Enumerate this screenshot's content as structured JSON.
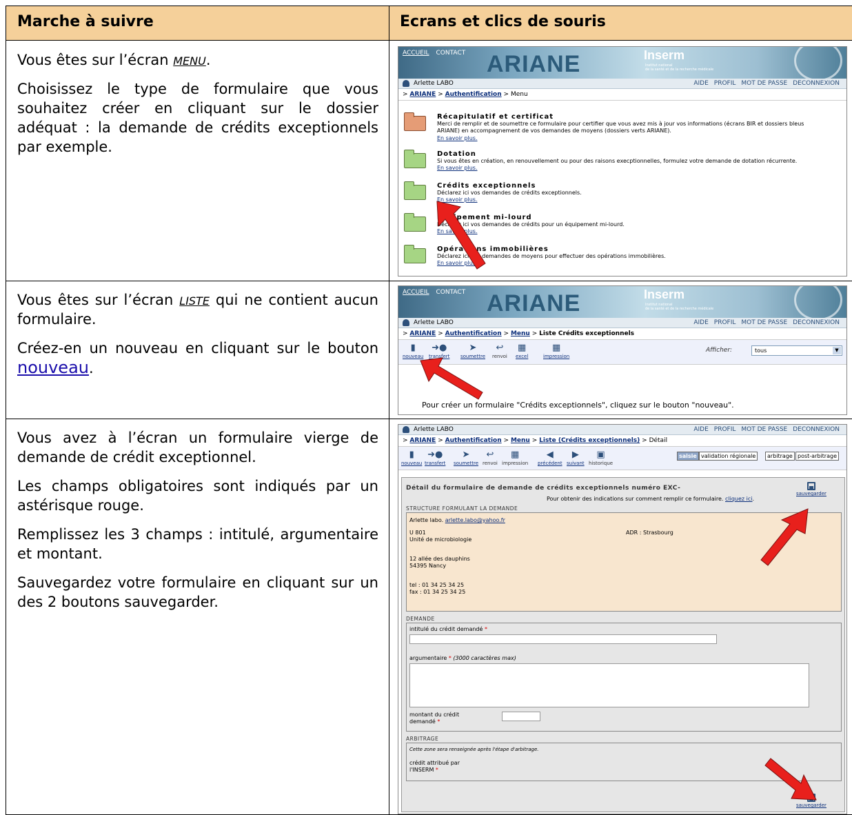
{
  "table": {
    "col1_header": "Marche à suivre",
    "col2_header": "Ecrans et clics de souris"
  },
  "row1": {
    "p1_pre": "Vous êtes sur l’écran ",
    "p1_screen": "MENU",
    "p1_post": ".",
    "p2": "Choisissez le type de formulaire que vous souhaitez créer en cliquant sur le dossier adéquat : la demande de crédits exceptionnels par exemple."
  },
  "row2": {
    "p1_pre": "Vous êtes sur l’écran ",
    "p1_screen": "LISTE",
    "p1_post": " qui ne contient aucun formulaire.",
    "p2_pre": "Créez-en un nouveau en cliquant sur le bouton ",
    "p2_link": "nouveau",
    "p2_post": "."
  },
  "row3": {
    "p1": "Vous avez à l’écran un formulaire vierge de demande de crédit exceptionnel.",
    "p2": "Les champs obligatoires sont indiqués par un astérisque rouge.",
    "p3": "Remplissez les 3 champs : intitulé, argumentaire et montant.",
    "p4": "Sauvegardez votre formulaire en cliquant sur un des 2 boutons sauvegarder."
  },
  "app": {
    "accueil": "ACCUEIL",
    "contact": "CONTACT",
    "logo": "ARIANE",
    "inserm": "Inserm",
    "inserm_sub1": "Institut national",
    "inserm_sub2": "de la santé et de la recherche médicale",
    "user": "Arlette LABO",
    "user_upper": "Arlette LABO",
    "links": [
      "AIDE",
      "PROFIL",
      "MOT DE PASSE",
      "DECONNEXION"
    ],
    "crumb_gt": ">",
    "crumb_ariane": "ARIANE",
    "crumb_auth": "Authentification",
    "crumb_menu": "Menu",
    "crumb_liste": "Liste Crédits exceptionnels",
    "crumb_liste2": "Liste (Crédits exceptionnels)",
    "crumb_detail": "Détail"
  },
  "menu": {
    "items": [
      {
        "title": "Récapitulatif et certificat",
        "desc1": "Merci de remplir et de soumettre ce formulaire pour certifier que vous avez mis à jour vos informations (écrans BIR et dossiers bleus",
        "desc2": "ARIANE) en accompagnement de vos demandes de moyens (dossiers verts ARIANE).",
        "more": "En savoir plus."
      },
      {
        "title": "Dotation",
        "desc1": "Si vous êtes en création, en renouvellement ou pour des raisons execptionnelles, formulez votre demande de dotation récurrente.",
        "desc2": "",
        "more": "En savoir plus."
      },
      {
        "title": "Crédits exceptionnels",
        "desc1": "Déclarez ici vos demandes de crédits exceptionnels.",
        "desc2": "",
        "more": "En savoir plus."
      },
      {
        "title": "Equipement mi-lourd",
        "desc1": "Déclarez ici vos demandes de crédits pour un équipement mi-lourd.",
        "desc2": "",
        "more": "En savoir plus."
      },
      {
        "title": "Opérations immobilières",
        "desc1": "Déclarez ici vos demandes de moyens pour effectuer des opérations immobilières.",
        "desc2": "",
        "more": "En savoir plus."
      }
    ]
  },
  "liste": {
    "buttons": [
      "nouveau",
      "transfert",
      "soumettre",
      "renvoi",
      "excel",
      "impression"
    ],
    "afficher": "Afficher:",
    "filter": "tous",
    "empty": "Pour créer un formulaire \"Crédits exceptionnels\", cliquez sur le bouton \"nouveau\"."
  },
  "detail": {
    "buttons": [
      "nouveau",
      "transfert",
      "soumettre",
      "renvoi",
      "impression",
      "précédent",
      "suivant",
      "historique"
    ],
    "tags": [
      "saisie",
      "validation régionale",
      "arbitrage",
      "post-arbitrage"
    ],
    "title": "Détail du formulaire de demande de crédits exceptionnels numéro EXC-",
    "save": "sauvegarder",
    "hint_pre": "Pour obtenir des indications sur comment remplir ce formulaire. ",
    "hint_link": "cliquez ici",
    "hint_post": ".",
    "sect_structure": "STRUCTURE FORMULANT LA DEMANDE",
    "person": "Arlette labo.",
    "email": "arlette.labo@yahoo.fr",
    "unit": "U 801",
    "unit_name": "Unité de microbiologie",
    "adr": "ADR : Strasbourg",
    "addr1": "12 allée des dauphins",
    "addr2": "54395 Nancy",
    "tel": "tel : 01 34 25 34 25",
    "fax": "fax : 01 34 25 34 25",
    "sect_demande": "DEMANDE",
    "intitule": "intitulé du crédit demandé",
    "argumentaire": "argumentaire",
    "argu_hint": "(3000 caractères max)",
    "montant1": "montant du crédit",
    "montant2": "demandé",
    "star": "*",
    "sect_arbitrage": "ARBITRAGE",
    "arb_note": "Cette zone sera renseignée après l'étape d'arbitrage.",
    "credit1": "crédit attribué par",
    "credit2": "l'INSERM"
  },
  "colors": {
    "header_bg": "#f5d09a",
    "arrow": "#e8201c",
    "folder_green": "#a6d584",
    "folder_orange": "#e59c76",
    "structure_bg": "#f8e6cf"
  },
  "icons": [
    "folder-icon",
    "red-arrow-icon",
    "user-icon",
    "save-disk-icon",
    "toolbar-icon"
  ]
}
